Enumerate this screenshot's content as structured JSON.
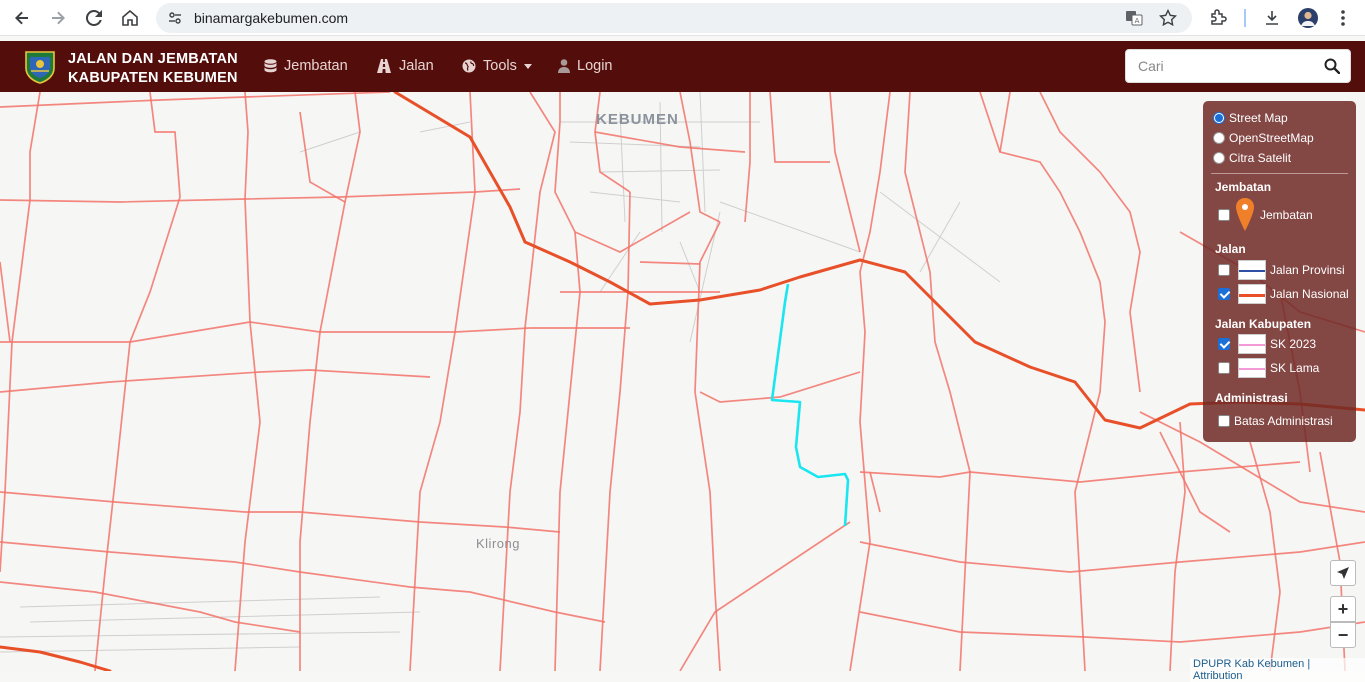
{
  "browser": {
    "url": "binamargakebumen.com"
  },
  "navbar": {
    "brand_line1": "JALAN DAN JEMBATAN",
    "brand_line2": "KABUPATEN KEBUMEN",
    "items": [
      {
        "label": "Jembatan",
        "icon": "database-icon"
      },
      {
        "label": "Jalan",
        "icon": "road-icon"
      },
      {
        "label": "Tools",
        "icon": "globe-icon"
      },
      {
        "label": "Login",
        "icon": "user-icon"
      }
    ],
    "search_placeholder": "Cari"
  },
  "map": {
    "places": {
      "kebumen": "KEBUMEN",
      "klirong": "Klirong"
    },
    "colors": {
      "road_kabupaten": "#f2736a",
      "road_nasional": "#e8502a",
      "sk2023_highlight": "#19e6f0"
    }
  },
  "layers": {
    "basemaps": [
      {
        "label": "Street Map",
        "selected": true
      },
      {
        "label": "OpenStreetMap",
        "selected": false
      },
      {
        "label": "Citra Satelit",
        "selected": false
      }
    ],
    "jembatan_heading": "Jembatan",
    "jembatan_item": "Jembatan",
    "jalan_heading": "Jalan",
    "jalan_items": [
      {
        "label": "Jalan Provinsi",
        "checked": false
      },
      {
        "label": "Jalan Nasional",
        "checked": true
      }
    ],
    "kabupaten_heading": "Jalan Kabupaten",
    "kabupaten_items": [
      {
        "label": "SK 2023",
        "checked": true
      },
      {
        "label": "SK Lama",
        "checked": false
      }
    ],
    "admin_heading": "Administrasi",
    "admin_item": "Batas Administrasi"
  },
  "controls": {
    "zoom_in": "+",
    "zoom_out": "−"
  },
  "attribution": {
    "owner": "DPUPR Kab Kebumen",
    "separator": " | ",
    "link": "Attribution"
  }
}
